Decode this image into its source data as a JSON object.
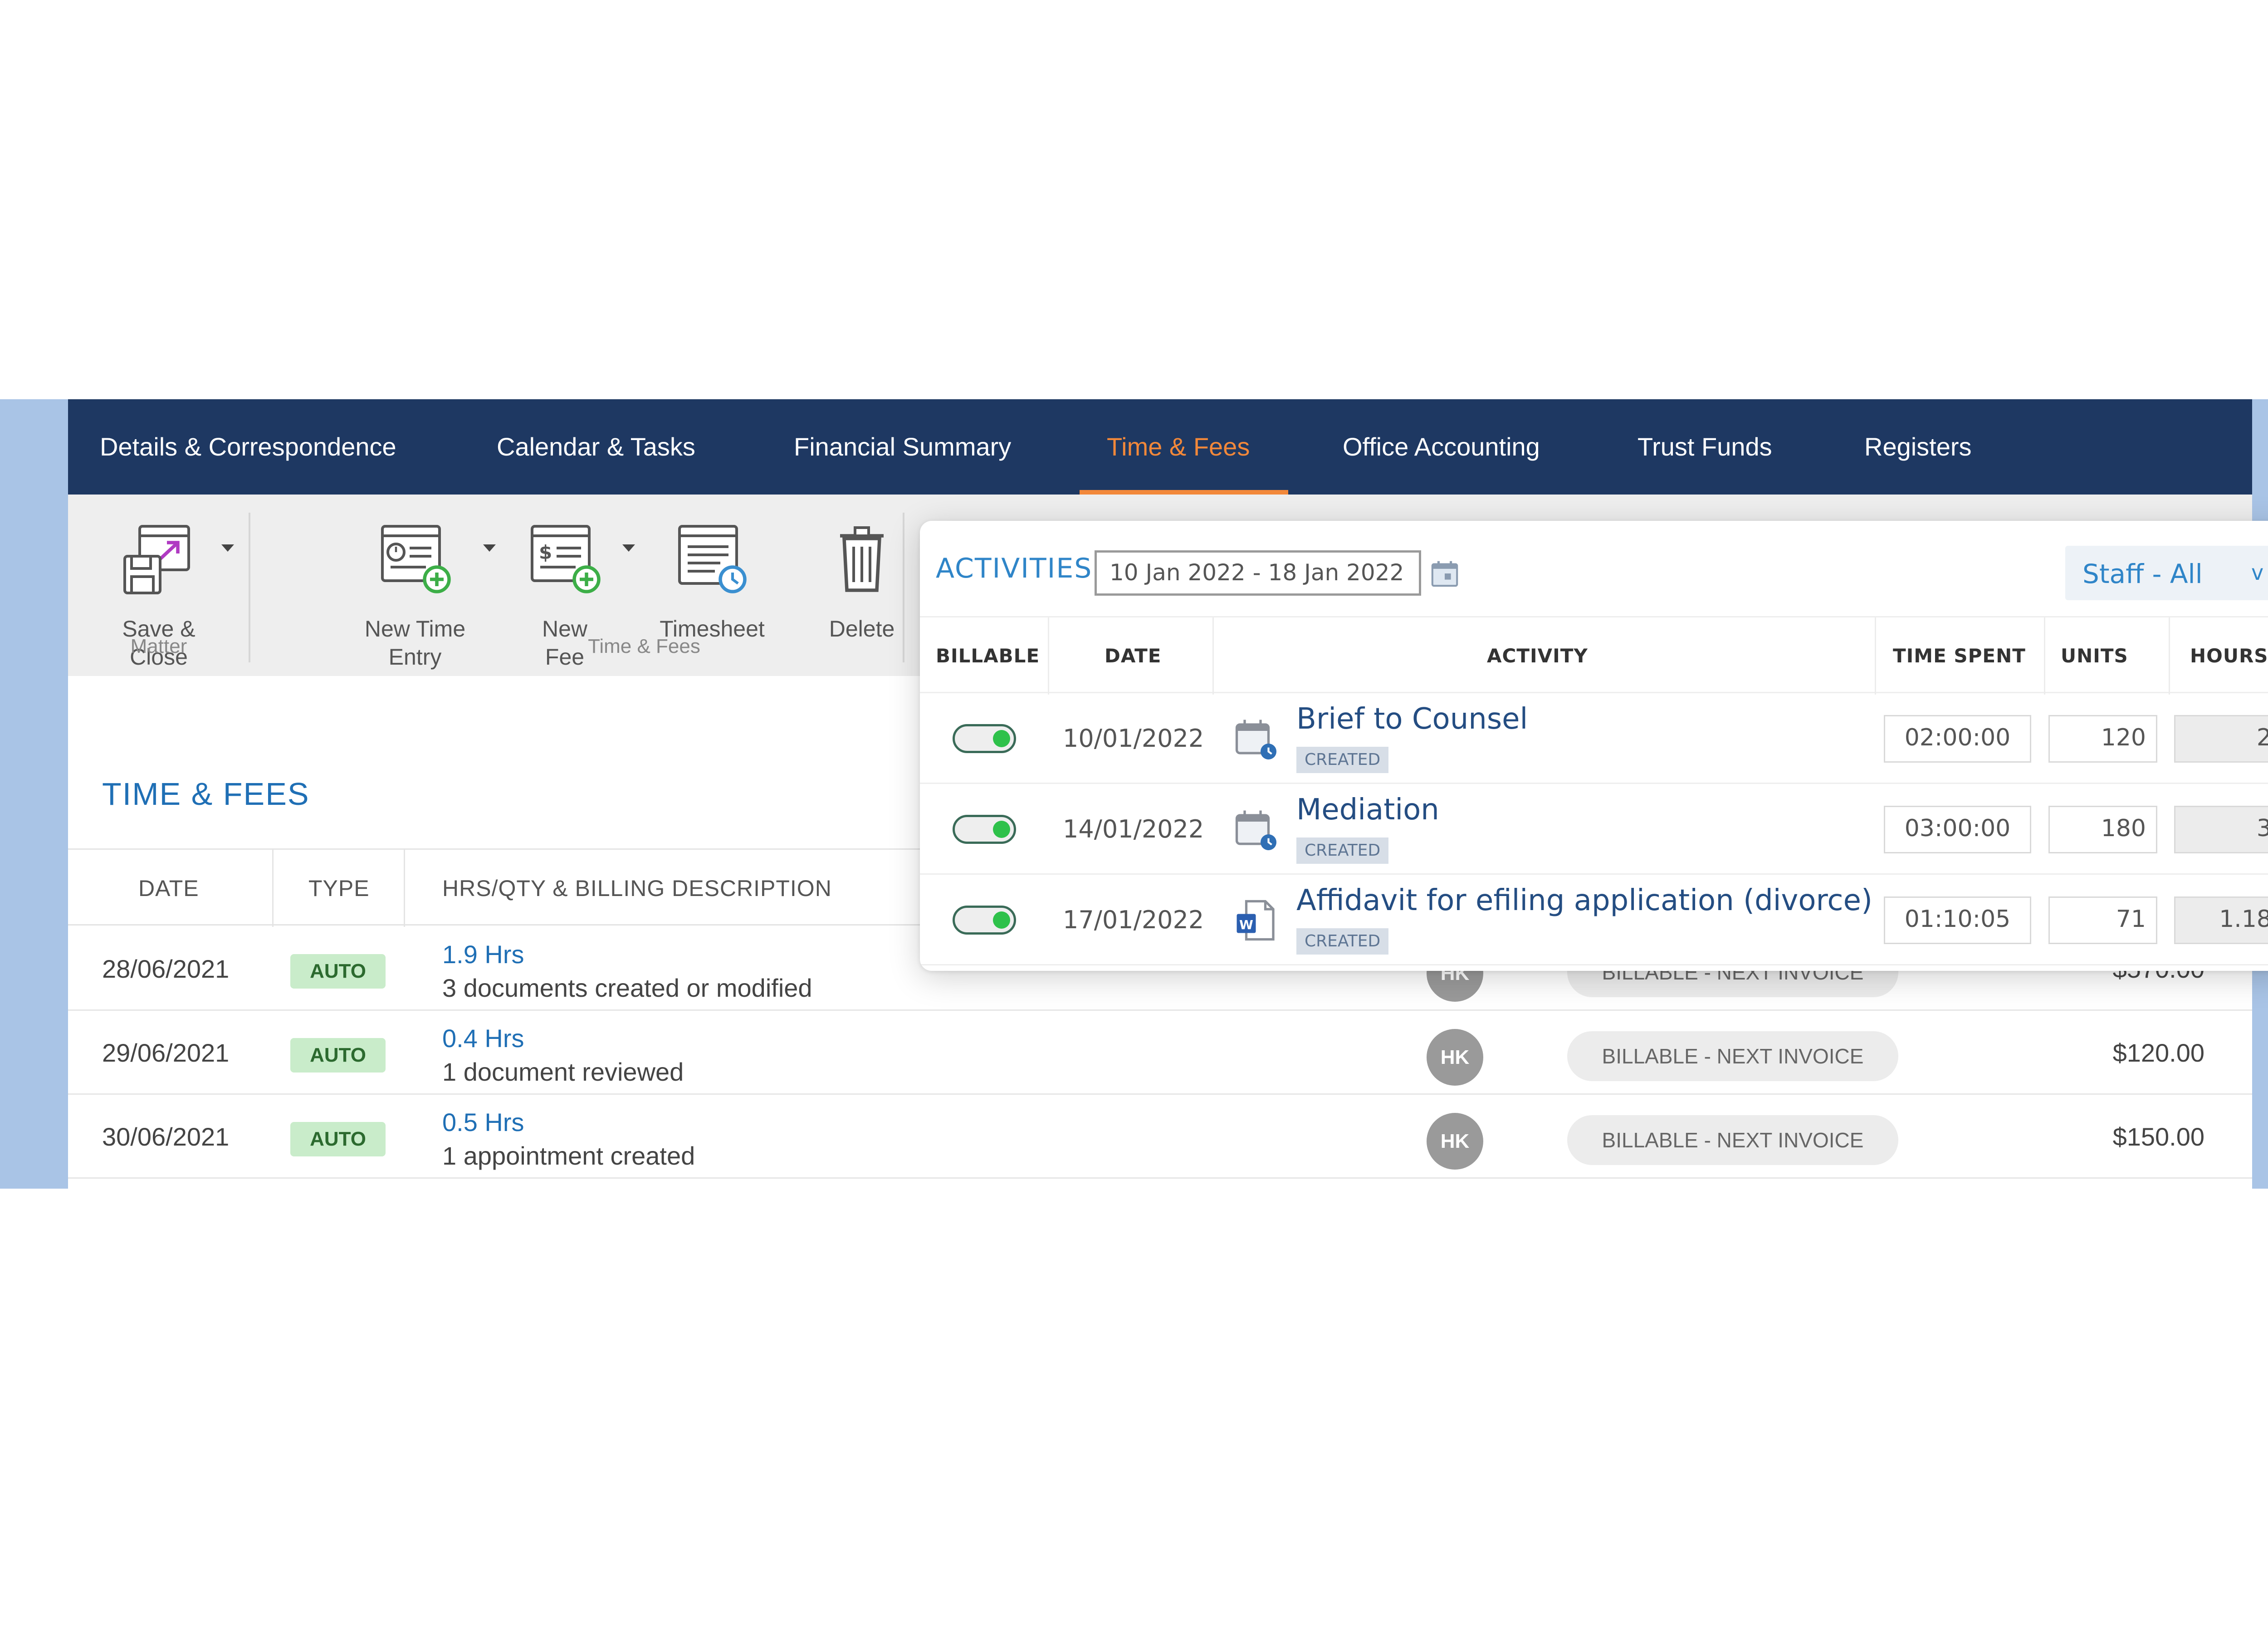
{
  "nav": {
    "tabs": [
      {
        "label": "Details & Correspondence"
      },
      {
        "label": "Calendar & Tasks"
      },
      {
        "label": "Financial Summary"
      },
      {
        "label": "Time & Fees",
        "active": true
      },
      {
        "label": "Office Accounting"
      },
      {
        "label": "Trust Funds"
      },
      {
        "label": "Registers"
      }
    ]
  },
  "ribbon": {
    "buttons": [
      {
        "label_line1": "Save &",
        "label_line2": "Close",
        "icon": "save-close-icon"
      },
      {
        "label_line1": "New Time",
        "label_line2": "Entry",
        "icon": "new-time-entry-icon"
      },
      {
        "label_line1": "New",
        "label_line2": "Fee",
        "icon": "new-fee-icon"
      },
      {
        "label_line1": "Timesheet",
        "label_line2": "",
        "icon": "timesheet-icon"
      },
      {
        "label_line1": "Delete",
        "label_line2": "",
        "icon": "trash-icon"
      }
    ],
    "groups": {
      "matter": "Matter",
      "time_fees": "Time & Fees"
    }
  },
  "main": {
    "section_title": "TIME & FEES",
    "columns": {
      "date": "DATE",
      "type": "TYPE",
      "description": "HRS/QTY & BILLING DESCRIPTION"
    },
    "rows": [
      {
        "date": "28/06/2021",
        "type": "AUTO",
        "hours": "1.9 Hrs",
        "description": "3 documents created or modified",
        "staff": "HK",
        "status": "BILLABLE - NEXT INVOICE",
        "amount": "$570.00"
      },
      {
        "date": "29/06/2021",
        "type": "AUTO",
        "hours": "0.4 Hrs",
        "description": "1 document reviewed",
        "staff": "HK",
        "status": "BILLABLE - NEXT INVOICE",
        "amount": "$120.00"
      },
      {
        "date": "30/06/2021",
        "type": "AUTO",
        "hours": "0.5 Hrs",
        "description": "1 appointment created",
        "staff": "HK",
        "status": "BILLABLE - NEXT INVOICE",
        "amount": "$150.00"
      }
    ]
  },
  "activities": {
    "title": "ACTIVITIES",
    "date_range": "10 Jan 2022 - 18 Jan 2022",
    "staff_filter": "Staff - All",
    "staff_chevron": "v",
    "columns": {
      "billable": "BILLABLE",
      "date": "DATE",
      "activity": "ACTIVITY",
      "time_spent": "TIME SPENT",
      "units": "UNITS",
      "hours": "HOURS"
    },
    "rows": [
      {
        "billable": true,
        "date": "10/01/2022",
        "icon": "calendar-icon",
        "activity": "Brief to Counsel",
        "badge": "CREATED",
        "time_spent": "02:00:00",
        "units": "120",
        "hours": "2"
      },
      {
        "billable": true,
        "date": "14/01/2022",
        "icon": "calendar-icon",
        "activity": "Mediation",
        "badge": "CREATED",
        "time_spent": "03:00:00",
        "units": "180",
        "hours": "3"
      },
      {
        "billable": true,
        "date": "17/01/2022",
        "icon": "word-document-icon",
        "activity": "Affidavit for efiling application (divorce)",
        "badge": "CREATED",
        "time_spent": "01:10:05",
        "units": "71",
        "hours": "1.18"
      }
    ]
  },
  "colors": {
    "nav_background": "#1e3862",
    "active_tab": "#f2883a",
    "accent_blue": "#1f6fb5",
    "auto_badge": "#c9ecca",
    "toggle_on": "#2ec14a",
    "side_band": "#a9c4e6"
  }
}
